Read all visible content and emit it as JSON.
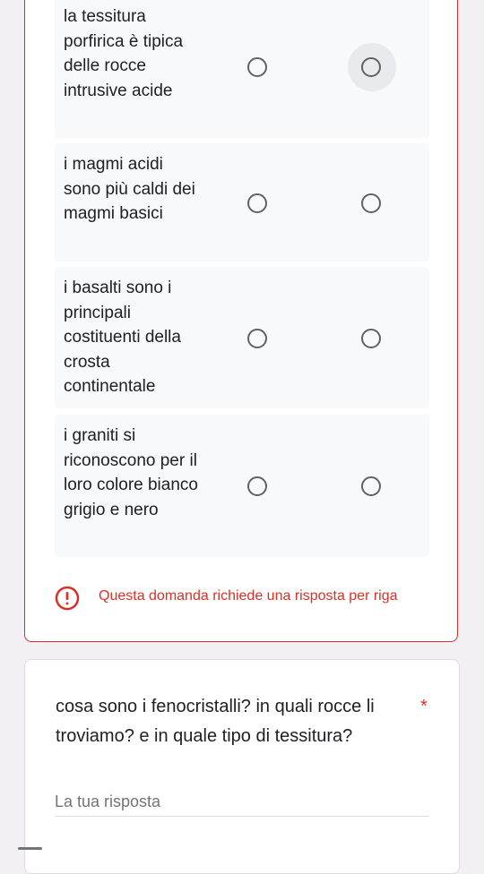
{
  "grid_question": {
    "rows": [
      {
        "label": "la tessitura porfirica è tipica delle rocce intrusive acide"
      },
      {
        "label": "i magmi acidi sono più caldi dei magmi basici"
      },
      {
        "label": "i basalti sono i principali costituenti della crosta continentale"
      },
      {
        "label": "i graniti si riconoscono per il loro colore bianco grigio e nero"
      }
    ],
    "error_message": "Questa domanda richiede una risposta per riga",
    "error_icon": "exclamation-circle-icon",
    "colors": {
      "error": "#d93025",
      "row_bg": "#f8f9fa"
    }
  },
  "text_question": {
    "title": "cosa sono i fenocristalli?  in quali rocce li troviamo? e in quale tipo di tessitura?",
    "required_marker": "*",
    "placeholder": "La tua risposta"
  }
}
